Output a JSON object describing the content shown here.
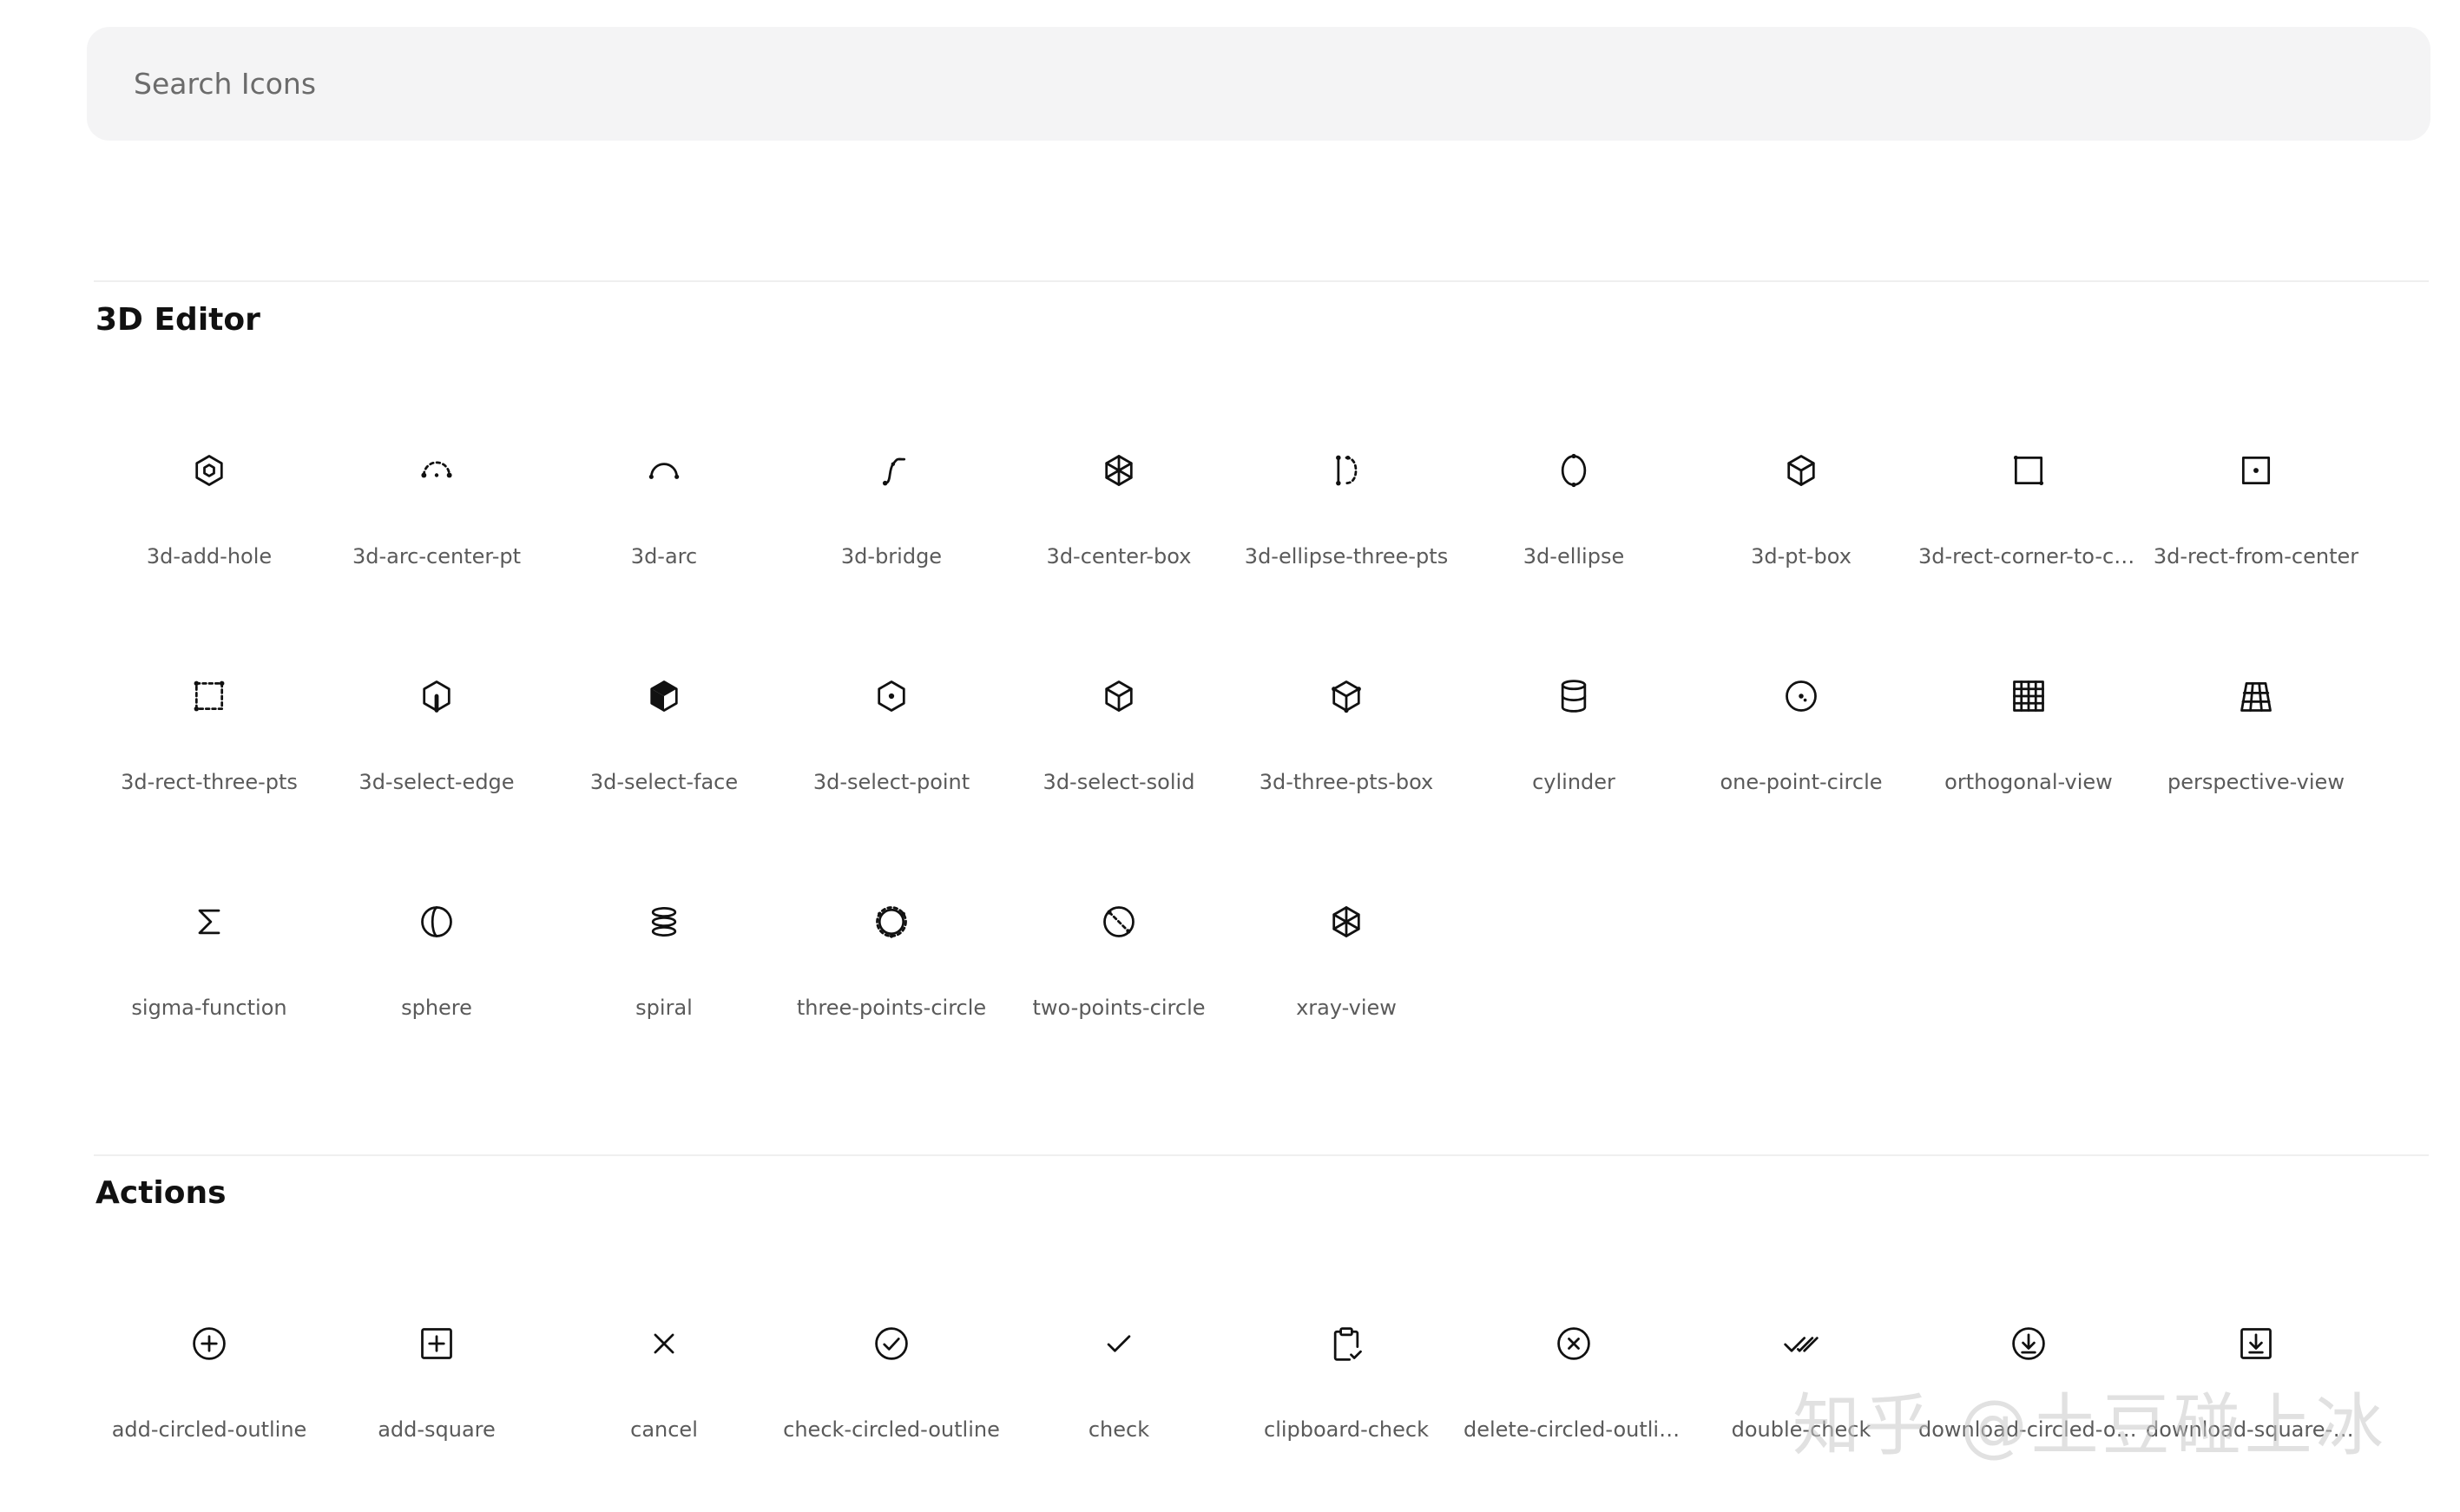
{
  "search": {
    "placeholder": "Search Icons",
    "value": ""
  },
  "sections": [
    {
      "title": "3D Editor",
      "icons": [
        {
          "label": "3d-add-hole",
          "icon": "3d-add-hole-icon"
        },
        {
          "label": "3d-arc-center-pt",
          "icon": "3d-arc-center-pt-icon"
        },
        {
          "label": "3d-arc",
          "icon": "3d-arc-icon"
        },
        {
          "label": "3d-bridge",
          "icon": "3d-bridge-icon"
        },
        {
          "label": "3d-center-box",
          "icon": "3d-center-box-icon"
        },
        {
          "label": "3d-ellipse-three-pts",
          "icon": "3d-ellipse-three-pts-icon"
        },
        {
          "label": "3d-ellipse",
          "icon": "3d-ellipse-icon"
        },
        {
          "label": "3d-pt-box",
          "icon": "3d-pt-box-icon"
        },
        {
          "label": "3d-rect-corner-to-co...",
          "icon": "3d-rect-corner-to-corner-icon"
        },
        {
          "label": "3d-rect-from-center",
          "icon": "3d-rect-from-center-icon"
        },
        {
          "label": "3d-rect-three-pts",
          "icon": "3d-rect-three-pts-icon"
        },
        {
          "label": "3d-select-edge",
          "icon": "3d-select-edge-icon"
        },
        {
          "label": "3d-select-face",
          "icon": "3d-select-face-icon"
        },
        {
          "label": "3d-select-point",
          "icon": "3d-select-point-icon"
        },
        {
          "label": "3d-select-solid",
          "icon": "3d-select-solid-icon"
        },
        {
          "label": "3d-three-pts-box",
          "icon": "3d-three-pts-box-icon"
        },
        {
          "label": "cylinder",
          "icon": "cylinder-icon"
        },
        {
          "label": "one-point-circle",
          "icon": "one-point-circle-icon"
        },
        {
          "label": "orthogonal-view",
          "icon": "orthogonal-view-icon"
        },
        {
          "label": "perspective-view",
          "icon": "perspective-view-icon"
        },
        {
          "label": "sigma-function",
          "icon": "sigma-function-icon"
        },
        {
          "label": "sphere",
          "icon": "sphere-icon"
        },
        {
          "label": "spiral",
          "icon": "spiral-icon"
        },
        {
          "label": "three-points-circle",
          "icon": "three-points-circle-icon"
        },
        {
          "label": "two-points-circle",
          "icon": "two-points-circle-icon"
        },
        {
          "label": "xray-view",
          "icon": "xray-view-icon"
        }
      ]
    },
    {
      "title": "Actions",
      "icons": [
        {
          "label": "add-circled-outline",
          "icon": "add-circled-outline-icon"
        },
        {
          "label": "add-square",
          "icon": "add-square-icon"
        },
        {
          "label": "cancel",
          "icon": "cancel-icon"
        },
        {
          "label": "check-circled-outline",
          "icon": "check-circled-outline-icon"
        },
        {
          "label": "check",
          "icon": "check-icon"
        },
        {
          "label": "clipboard-check",
          "icon": "clipboard-check-icon"
        },
        {
          "label": "delete-circled-outline",
          "icon": "delete-circled-outline-icon"
        },
        {
          "label": "double-check",
          "icon": "double-check-icon"
        },
        {
          "label": "download-circled-out...",
          "icon": "download-circled-outline-icon"
        },
        {
          "label": "download-square-out...",
          "icon": "download-square-outline-icon"
        }
      ]
    }
  ],
  "watermark": "知乎 @土豆碰上冰"
}
